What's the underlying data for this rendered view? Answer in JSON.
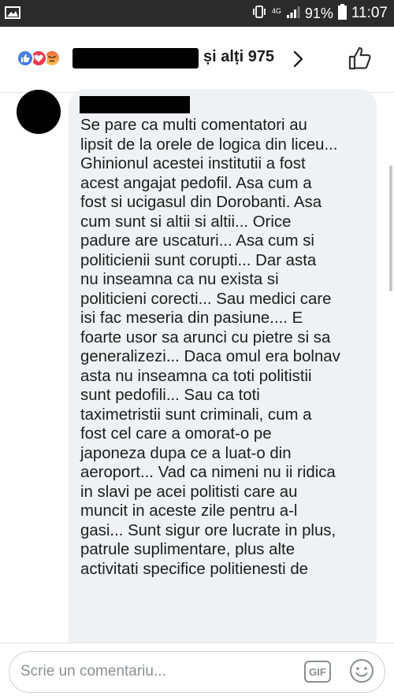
{
  "status_bar": {
    "network": "4G",
    "battery": "91%",
    "time": "11:07",
    "icons": [
      "image-icon",
      "vibrate-icon",
      "signal-icon",
      "battery-icon"
    ]
  },
  "header": {
    "reactions": [
      "like-icon",
      "love-icon",
      "angry-icon"
    ],
    "others_text": "și alți 975",
    "chevron": "chevron-right-icon",
    "like_button": "thumbs-up-icon"
  },
  "comment": {
    "text": "Se pare ca multi comentatori au\nlipsit de la orele de logica din liceu...\nGhinionul acestei institutii a fost\nacest angajat pedofil. Asa cum a\nfost si ucigasul din Dorobanti. Asa\ncum sunt si altii si altii... Orice\npadure are uscaturi... Asa cum si\npoliticienii sunt corupti... Dar asta\nnu inseamna ca nu exista si\npoliticieni corecti... Sau medici care\nisi fac meseria din pasiune.... E\nfoarte usor sa arunci cu pietre si sa\ngeneralizezi... Daca omul era bolnav\nasta nu inseamna ca toti politistii\nsunt pedofili... Sau ca toti\ntaximetristii sunt criminali, cum a\nfost cel care a omorat-o pe\njaponeza dupa ce a luat-o din\naeroport... Vad ca nimeni nu ii ridica\nin slavi pe acei politisti care au\nmuncit in aceste zile pentru a-l\ngasi... Sunt sigur ore lucrate in plus,\npatrule suplimentare, plus alte\nactivitati specifice politienesti de"
  },
  "composer": {
    "placeholder": "Scrie un comentariu...",
    "gif_label": "GIF",
    "emoji_icon": "smiley-icon"
  },
  "colors": {
    "like_blue": "#4a7ee6",
    "love_red": "#ef3a4f",
    "bubble_bg": "#f0f1f4",
    "status_bar_bg": "#2b2b2b"
  }
}
